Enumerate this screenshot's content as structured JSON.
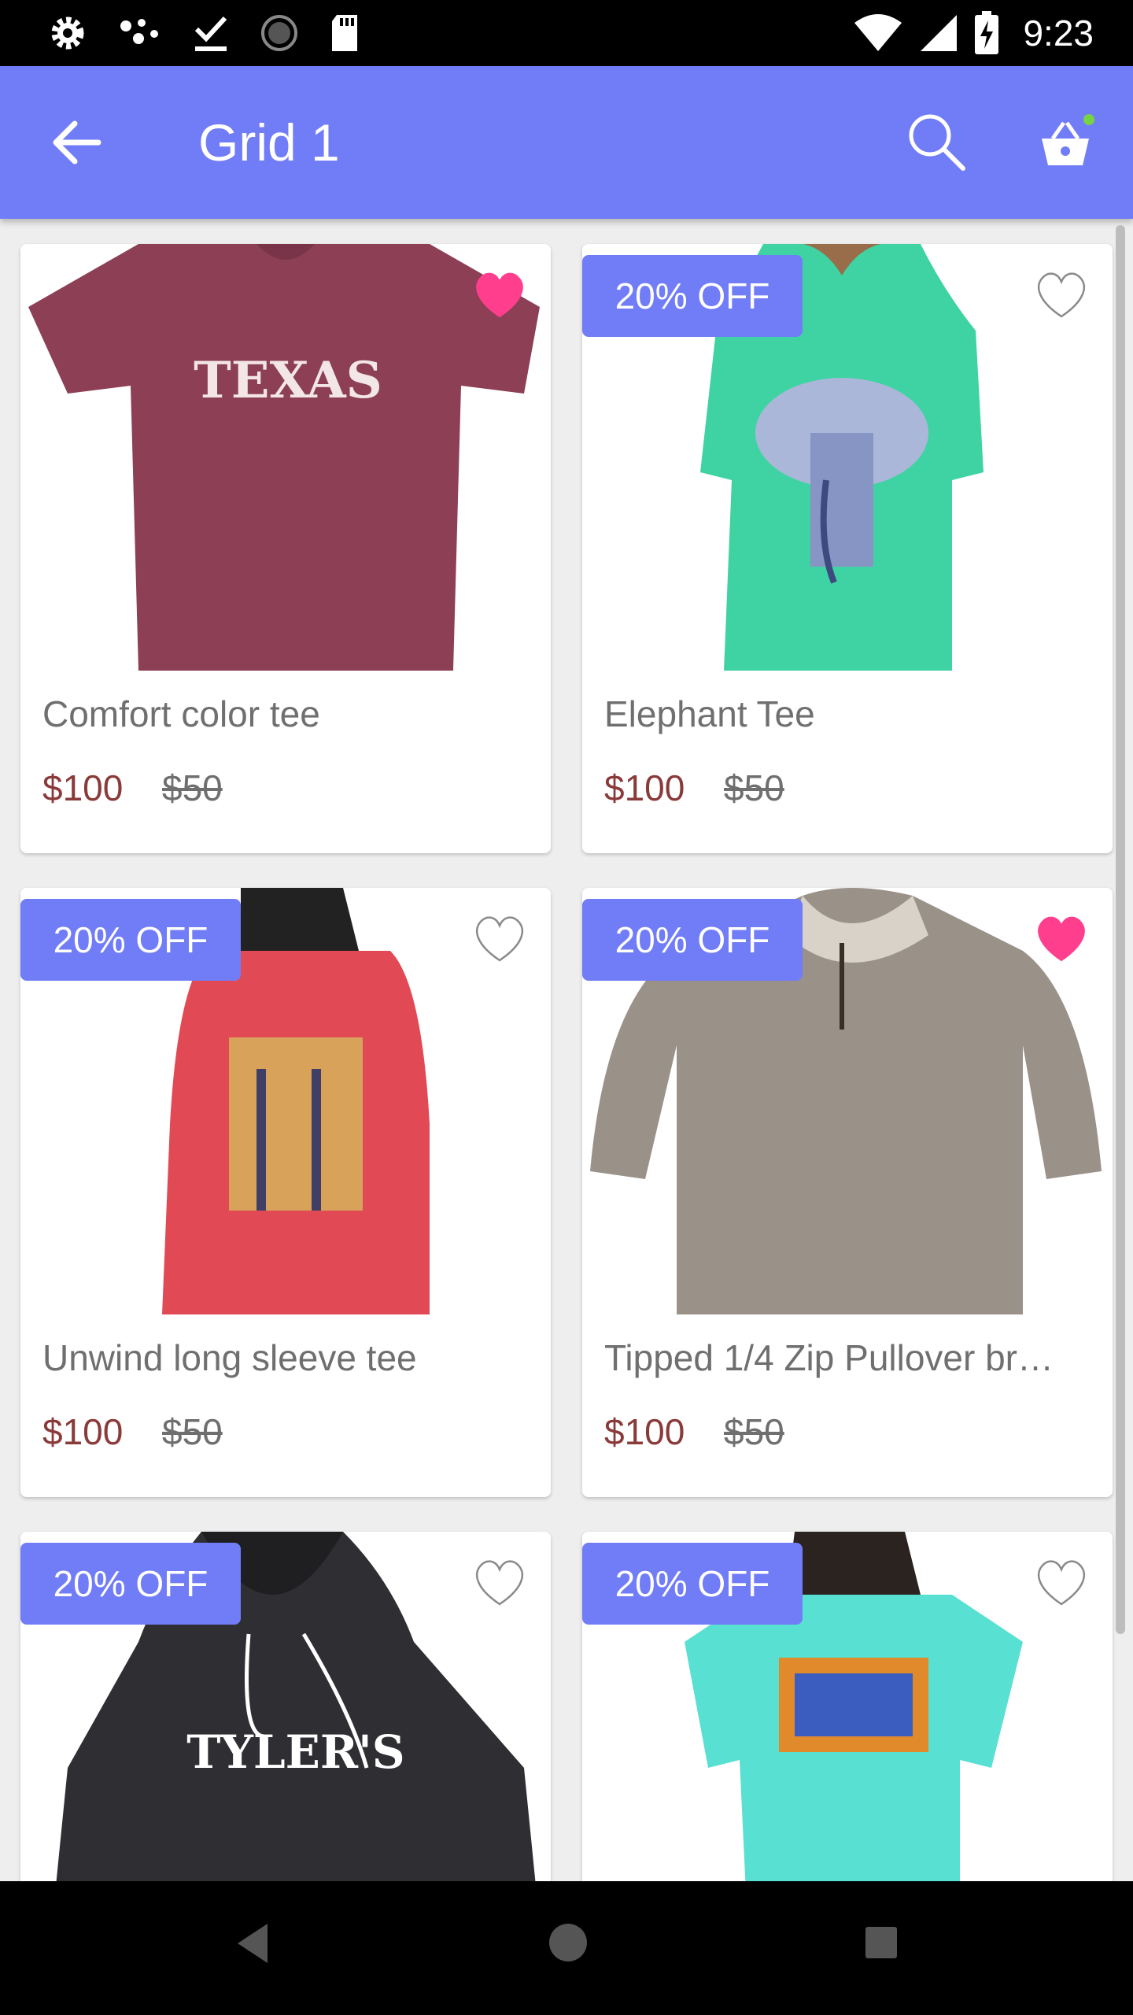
{
  "status_bar": {
    "time": "9:23",
    "left_icons": [
      "settings-icon",
      "dots-icon",
      "download-done-icon",
      "loading-icon",
      "sd-card-icon"
    ],
    "right_icons": [
      "wifi-icon",
      "signal-icon",
      "battery-charging-icon"
    ]
  },
  "app_bar": {
    "title": "Grid 1",
    "back_icon": "arrow-back-icon",
    "search_icon": "search-icon",
    "cart_icon": "basket-icon",
    "color": "#717cf7",
    "cart_dot_color": "#76d442"
  },
  "products": [
    {
      "name": "Comfort color tee",
      "price": "$100",
      "old_price": "$50",
      "badge": "",
      "favorite": true,
      "image": "maroon texas t-shirt"
    },
    {
      "name": "Elephant Tee",
      "price": "$100",
      "old_price": "$50",
      "badge": "20% OFF",
      "favorite": false,
      "image": "mint elephant t-shirt"
    },
    {
      "name": "Unwind long sleeve tee",
      "price": "$100",
      "old_price": "$50",
      "badge": "20% OFF",
      "favorite": false,
      "image": "red long sleeve tee"
    },
    {
      "name": "Tipped 1/4 Zip Pullover br…",
      "price": "$100",
      "old_price": "$50",
      "badge": "20% OFF",
      "favorite": true,
      "image": "grey sherpa pullover"
    },
    {
      "name": "",
      "price": "",
      "old_price": "",
      "badge": "20% OFF",
      "favorite": false,
      "image": "black tylers hoodie"
    },
    {
      "name": "",
      "price": "",
      "old_price": "",
      "badge": "20% OFF",
      "favorite": false,
      "image": "aqua graphic t-shirt"
    }
  ],
  "tee_texts": {
    "texas": "TEXAS",
    "tylers": "TYLER'S"
  },
  "colors": {
    "price": "#8b3a3a",
    "heart_active": "#ff3f8e",
    "accent": "#717cf7"
  },
  "nav_bar": {
    "icons": [
      "nav-back-icon",
      "nav-home-icon",
      "nav-recent-icon"
    ]
  }
}
